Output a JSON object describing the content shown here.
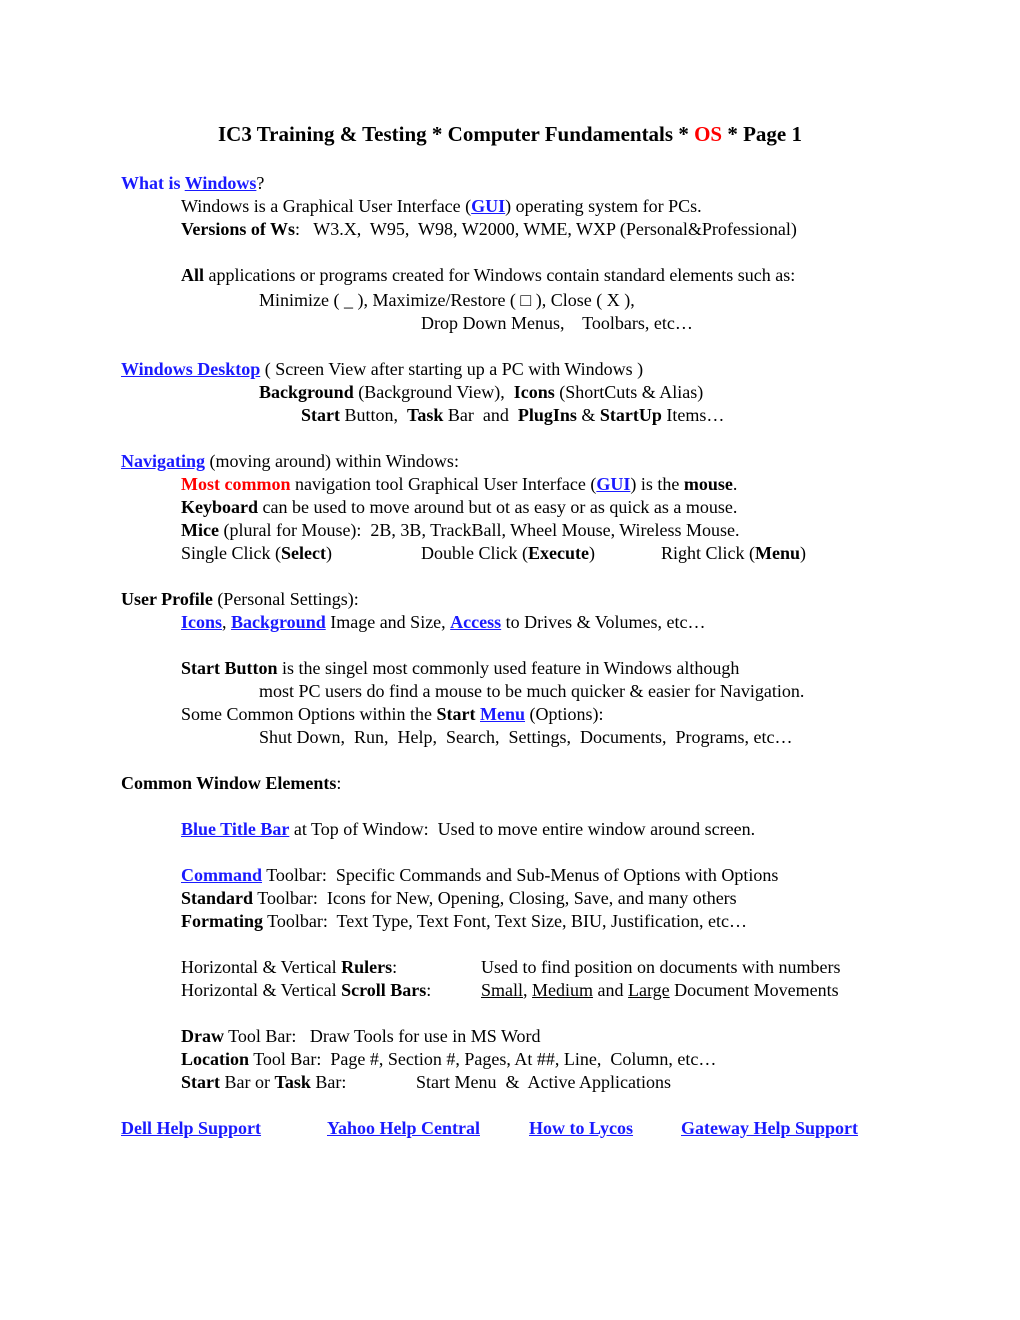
{
  "title": {
    "part1": "IC3 Training & Testing * Computer Fundamentals * ",
    "highlight": "OS",
    "part2": " * Page 1"
  },
  "what_is_windows": {
    "heading_prefix": "What is ",
    "heading_link": "Windows",
    "heading_suffix": "?",
    "line1_prefix": "Windows is a Graphical User Interface (",
    "line1_link": "GUI",
    "line1_suffix": ") operating system for PCs.",
    "versions_label": "Versions of Ws",
    "versions_text": ":   W3.X,  W95,  W98, W2000, WME, WXP (Personal&Professional)"
  },
  "standard_elements": {
    "all_bold": "All",
    "intro": " applications or programs created for Windows contain standard elements such as:",
    "controls": "Minimize ( _ ), Maximize/Restore ( □ ), Close ( X ),",
    "more": "Drop Down Menus,    Toolbars, etc…"
  },
  "desktop": {
    "link": "Windows Desktop",
    "desc": " ( Screen View after starting up a PC with Windows )",
    "background_bold": "Background",
    "background_text": " (Background View),  ",
    "icons_bold": "Icons",
    "icons_text": " (ShortCuts & Alias)",
    "start_bold": "Start",
    "start_text": " Button,  ",
    "task_bold": "Task",
    "task_text": " Bar  and  ",
    "plugins_bold": "PlugIns",
    "amp": " & ",
    "startup_bold": "StartUp",
    "items_text": " Items…"
  },
  "navigating": {
    "link": "Navigating",
    "desc": " (moving around) within Windows:",
    "most_common": "Most common",
    "line1_mid": " navigation tool Graphical User Interface (",
    "line1_link": "GUI",
    "line1_mid2": ") is the ",
    "mouse_bold": "mouse",
    "period": ".",
    "keyboard_bold": "Keyboard",
    "keyboard_text": " can be used to move around but ot as easy or as quick as a mouse.",
    "mice_bold": "Mice",
    "mice_text": " (plural for Mouse):  2B, 3B, TrackBall, Wheel Mouse, Wireless Mouse.",
    "clicks": [
      {
        "prefix": "Single Click (",
        "bold": "Select",
        "suffix": ")"
      },
      {
        "prefix": "Double Click (",
        "bold": "Execute",
        "suffix": ")"
      },
      {
        "prefix": "Right Click (",
        "bold": "Menu",
        "suffix": ")"
      }
    ]
  },
  "user_profile": {
    "heading_bold": "User Profile",
    "heading_text": " (Personal Settings):",
    "icons_link": "Icons",
    "comma": ", ",
    "background_link": "Background",
    "bg_text": " Image and Size, ",
    "access_link": "Access",
    "access_text": " to Drives & Volumes, etc…",
    "start_button_bold": "Start Button",
    "start_button_text": " is the singel most commonly used feature in Windows although",
    "start_button_cont": "most PC users do find a mouse to be much quicker & easier for Navigation.",
    "options_prefix": "Some Common Options within the ",
    "options_start_bold": "Start",
    "options_menu_link": "Menu",
    "options_suffix": " (Options):",
    "options_list": "Shut Down,  Run,  Help,  Search,  Settings,  Documents,  Programs, etc…"
  },
  "window_elements": {
    "heading_bold": "Common Window Elements",
    "heading_suffix": ":",
    "title_bar_link": "Blue Title Bar",
    "title_bar_text": " at Top of Window:  Used to move entire window around screen.",
    "command_link": "Command",
    "command_text": " Toolbar:  Specific Commands and Sub-Menus of Options with Options",
    "standard_bold": "Standard",
    "standard_text": " Toolbar:  Icons for New, Opening, Closing, Save, and many others",
    "formating_bold": "Formating",
    "formating_text": " Toolbar:  Text Type, Text Font, Text Size, BIU, Justification, etc…",
    "rulers_prefix": "Horizontal & Vertical ",
    "rulers_bold": "Rulers",
    "rulers_colon": ":",
    "rulers_desc": "Used to find position on documents with numbers",
    "scroll_prefix": "Horizontal & Vertical ",
    "scroll_bold": "Scroll Bars",
    "scroll_colon": ":",
    "scroll_small": "Small",
    "scroll_comma": ", ",
    "scroll_medium": "Medium",
    "scroll_and": " and ",
    "scroll_large": "Large",
    "scroll_rest": " Document Movements",
    "draw_bold": "Draw",
    "draw_text": " Tool Bar:   Draw Tools for use in MS Word",
    "location_bold": "Location",
    "location_text": " Tool Bar:  Page #, Section #, Pages, At ##, Line,  Column, etc…",
    "startbar_bold": "Start",
    "startbar_mid": " Bar or ",
    "taskbar_bold": "Task",
    "taskbar_text": " Bar:",
    "startbar_desc": "Start Menu  &  Active Applications"
  },
  "footer_links": [
    "Dell Help Support",
    "Yahoo Help Central",
    "How to Lycos",
    "Gateway Help Support"
  ]
}
